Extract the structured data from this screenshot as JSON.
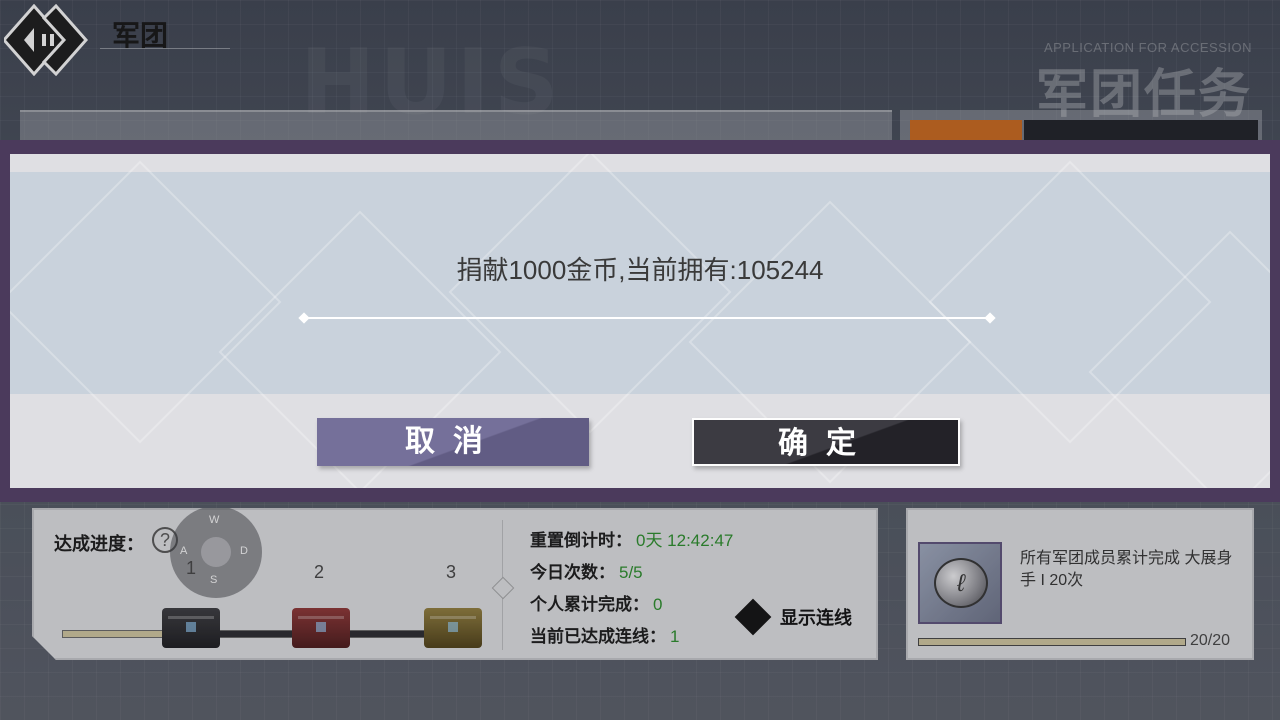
{
  "header": {
    "title": "军团",
    "sub_en": "APPLICATION FOR ACCESSION",
    "big_title": "军团任务",
    "watermark": "HUIS"
  },
  "progress_panel": {
    "label": "达成进度：",
    "help_glyph": "?",
    "joystick": {
      "w": "W",
      "a": "A",
      "s": "S",
      "d": "D"
    },
    "milestones": [
      "1",
      "2",
      "3"
    ],
    "progress_fraction": 0.25,
    "stats": [
      {
        "label": "重置倒计时：",
        "value": "0天 12:42:47"
      },
      {
        "label": "今日次数：",
        "value": "5/5"
      },
      {
        "label": "个人累计完成：",
        "value": "0"
      },
      {
        "label": "当前已达成连线：",
        "value": "1"
      }
    ],
    "show_line_label": "显示连线"
  },
  "task_panel": {
    "description": "所有军团成员累计完成 大展身手 I 20次",
    "progress_fraction": 1.0,
    "count": "20/20",
    "icon": "coin-icon"
  },
  "dialog": {
    "message": "捐献1000金币,当前拥有:105244",
    "cancel_label": "取消",
    "confirm_label": "确定"
  },
  "colors": {
    "dialog_frame": "#4b3a5c",
    "cancel_button": "#75709a",
    "confirm_button": "#3c3b42",
    "stat_value": "#2b8a2b",
    "orange_accent": "#c4661d"
  }
}
